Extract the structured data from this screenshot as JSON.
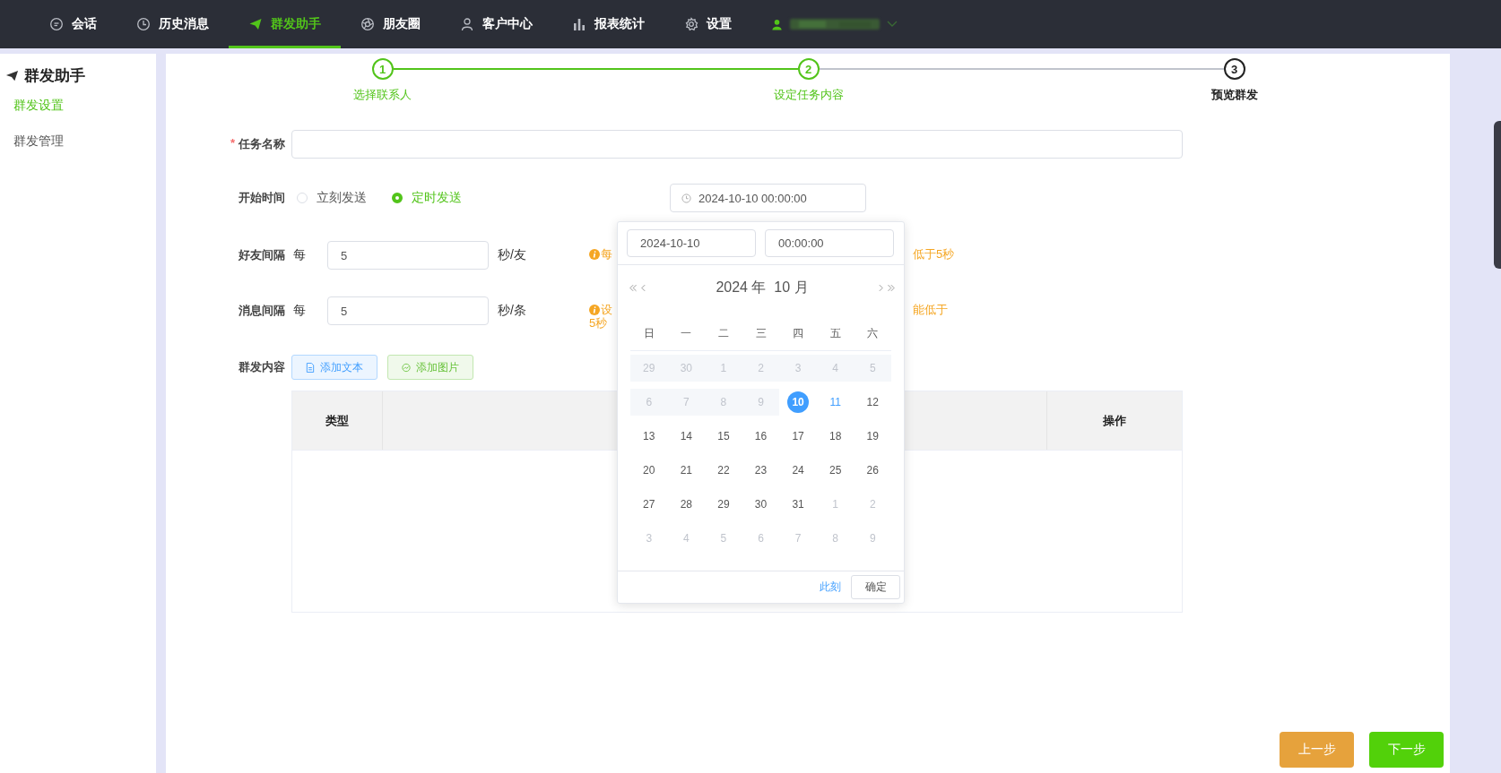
{
  "nav": {
    "items": [
      {
        "label": "会话",
        "selected": false
      },
      {
        "label": "历史消息",
        "selected": false
      },
      {
        "label": "群发助手",
        "selected": true
      },
      {
        "label": "朋友圈",
        "selected": false
      },
      {
        "label": "客户中心",
        "selected": false
      },
      {
        "label": "报表统计",
        "selected": false
      },
      {
        "label": "设置",
        "selected": false
      }
    ]
  },
  "sidebar": {
    "title": "群发助手",
    "items": [
      {
        "label": "群发设置",
        "selected": true
      },
      {
        "label": "群发管理",
        "selected": false
      }
    ]
  },
  "steps": [
    {
      "number": "1",
      "label": "选择联系人",
      "done": true
    },
    {
      "number": "2",
      "label": "设定任务内容",
      "done": true
    },
    {
      "number": "3",
      "label": "预览群发",
      "done": false
    }
  ],
  "form": {
    "task_name": {
      "label": "任务名称",
      "required_mark": "*"
    },
    "start_time": {
      "label": "开始时间",
      "options": [
        {
          "label": "立刻发送",
          "selected": false
        },
        {
          "label": "定时发送",
          "selected": true
        }
      ],
      "value": "2024-10-10 00:00:00"
    },
    "intervals": [
      {
        "label": "好友间隔",
        "prefix": "每",
        "value": "5",
        "unit": "秒/友",
        "hint_left": [
          "每"
        ],
        "hint_right": "低于5秒"
      },
      {
        "label": "消息间隔",
        "prefix": "每",
        "value": "5",
        "unit": "秒/条",
        "hint_left": [
          "设",
          "5秒"
        ],
        "hint_right": "能低于"
      }
    ],
    "content": {
      "label": "群发内容",
      "buttons": [
        {
          "label": "添加文本",
          "kind": "text"
        },
        {
          "label": "添加图片",
          "kind": "image"
        }
      ]
    }
  },
  "table": {
    "columns": [
      {
        "label": "类型"
      },
      {},
      {
        "label": "操作"
      }
    ]
  },
  "date_picker": {
    "date": "2024-10-10",
    "time": "00:00:00",
    "header": "2024 年  10 月",
    "weekdays": [
      "日",
      "一",
      "二",
      "三",
      "四",
      "五",
      "六"
    ],
    "weeks": [
      [
        {
          "label": "29",
          "kind": "disabled",
          "selected": false
        },
        {
          "label": "30",
          "kind": "disabled",
          "selected": false
        },
        {
          "label": "1",
          "kind": "disabled",
          "selected": false
        },
        {
          "label": "2",
          "kind": "disabled",
          "selected": false
        },
        {
          "label": "3",
          "kind": "disabled",
          "selected": false
        },
        {
          "label": "4",
          "kind": "disabled",
          "selected": false
        },
        {
          "label": "5",
          "kind": "disabled",
          "selected": false
        }
      ],
      [
        {
          "label": "6",
          "kind": "disabled",
          "selected": false
        },
        {
          "label": "7",
          "kind": "disabled",
          "selected": false
        },
        {
          "label": "8",
          "kind": "disabled",
          "selected": false
        },
        {
          "label": "9",
          "kind": "disabled",
          "selected": false
        },
        {
          "label": "10",
          "kind": "normal",
          "selected": true
        },
        {
          "label": "11",
          "kind": "today",
          "selected": false
        },
        {
          "label": "12",
          "kind": "normal",
          "selected": false
        }
      ],
      [
        {
          "label": "13",
          "kind": "normal",
          "selected": false
        },
        {
          "label": "14",
          "kind": "normal",
          "selected": false
        },
        {
          "label": "15",
          "kind": "normal",
          "selected": false
        },
        {
          "label": "16",
          "kind": "normal",
          "selected": false
        },
        {
          "label": "17",
          "kind": "normal",
          "selected": false
        },
        {
          "label": "18",
          "kind": "normal",
          "selected": false
        },
        {
          "label": "19",
          "kind": "normal",
          "selected": false
        }
      ],
      [
        {
          "label": "20",
          "kind": "normal",
          "selected": false
        },
        {
          "label": "21",
          "kind": "normal",
          "selected": false
        },
        {
          "label": "22",
          "kind": "normal",
          "selected": false
        },
        {
          "label": "23",
          "kind": "normal",
          "selected": false
        },
        {
          "label": "24",
          "kind": "normal",
          "selected": false
        },
        {
          "label": "25",
          "kind": "normal",
          "selected": false
        },
        {
          "label": "26",
          "kind": "normal",
          "selected": false
        }
      ],
      [
        {
          "label": "27",
          "kind": "normal",
          "selected": false
        },
        {
          "label": "28",
          "kind": "normal",
          "selected": false
        },
        {
          "label": "29",
          "kind": "normal",
          "selected": false
        },
        {
          "label": "30",
          "kind": "normal",
          "selected": false
        },
        {
          "label": "31",
          "kind": "normal",
          "selected": false
        },
        {
          "label": "1",
          "kind": "outside",
          "selected": false
        },
        {
          "label": "2",
          "kind": "outside",
          "selected": false
        }
      ],
      [
        {
          "label": "3",
          "kind": "outside",
          "selected": false
        },
        {
          "label": "4",
          "kind": "outside",
          "selected": false
        },
        {
          "label": "5",
          "kind": "outside",
          "selected": false
        },
        {
          "label": "6",
          "kind": "outside",
          "selected": false
        },
        {
          "label": "7",
          "kind": "outside",
          "selected": false
        },
        {
          "label": "8",
          "kind": "outside",
          "selected": false
        },
        {
          "label": "9",
          "kind": "outside",
          "selected": false
        }
      ]
    ],
    "now_link": "此刻",
    "confirm": "确定"
  },
  "footer": {
    "prev": "上一步",
    "next": "下一步"
  }
}
